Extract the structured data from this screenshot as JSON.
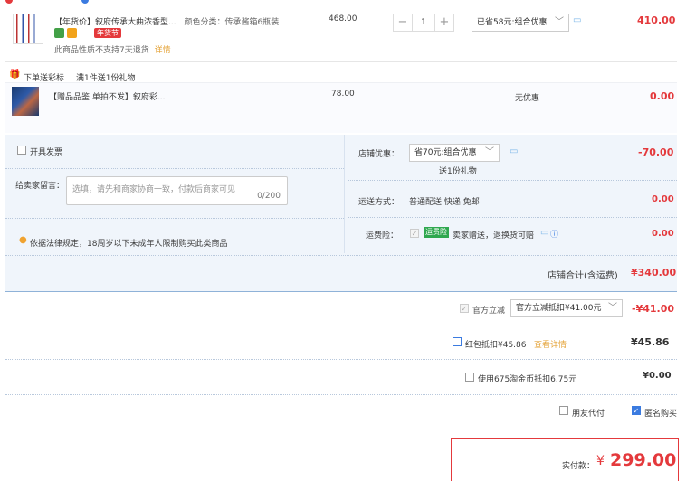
{
  "item1": {
    "title": "【年货价】叙府传承大曲浓香型...",
    "spec": "颜色分类：传承酱箱6瓶装",
    "price": "468.00",
    "quantity": "1",
    "badge": "年货节",
    "notice": "此商品性质不支持7天退货",
    "notice_link": "详情",
    "discount_select": "已省58元:组合优惠",
    "subtotal": "410.00"
  },
  "gift_bar": {
    "label": "下单送彩标",
    "desc": "满1件送1份礼物"
  },
  "item2": {
    "title": "【赠品品鉴 单拍不发】叙府彩...",
    "price": "78.00",
    "discount": "无优惠",
    "subtotal": "0.00"
  },
  "left_panel": {
    "invoice_label": "开具发票",
    "message_label": "给卖家留言：",
    "message_placeholder": "选填，请先和商家协商一致，付款后商家可见",
    "message_count": "0/200",
    "legal_notice": "依据法律规定，18周岁以下未成年人限制购买此类商品"
  },
  "right_panel": {
    "shop_discount_label": "店铺优惠：",
    "shop_discount_select": "省70元:组合优惠",
    "shop_discount_gift": "送1份礼物",
    "shop_discount_value": "-70.00",
    "delivery_label": "运送方式：",
    "delivery_desc": "普通配送 快递 免邮",
    "delivery_value": "0.00",
    "insurance_label": "运费险：",
    "insurance_badge": "运费险",
    "insurance_desc": "卖家赠送，退换货可赔",
    "insurance_value": "0.00"
  },
  "shop_total": {
    "label": "店铺合计(含运费)",
    "value": "¥340.00"
  },
  "official": {
    "label": "官方立减",
    "select": "官方立减抵扣¥41.00元",
    "value": "-¥41.00"
  },
  "redpacket": {
    "label": "红包抵扣¥45.86",
    "link": "查看详情",
    "value": "¥45.86"
  },
  "coins": {
    "label": "使用675淘金币抵扣6.75元",
    "value": "¥0.00"
  },
  "options": {
    "friend_pay": "朋友代付",
    "anonymous": "匿名购买"
  },
  "payment": {
    "label": "实付款：",
    "currency": "¥",
    "value": "299.00"
  },
  "colors": {
    "accent_red": "#e4393c",
    "panel_bg": "#f0f5fb",
    "link_orange": "#e4a43b",
    "check_blue": "#3b7be0"
  }
}
